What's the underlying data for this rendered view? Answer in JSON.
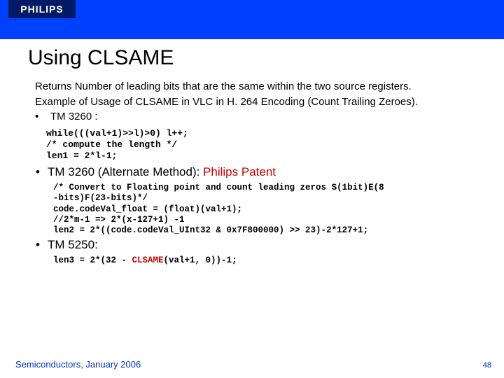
{
  "logo": "PHILIPS",
  "title": "Using CLSAME",
  "intro1": "Returns Number of leading bits that are the same within the two source registers.",
  "intro2": "Example of Usage of CLSAME in VLC in H. 264 Encoding (Count Trailing Zeroes).",
  "b1": "TM 3260 :",
  "code1": "while(((val+1)>>l)>0) l++;\n/* compute the length */\nlen1 = 2*l-1;",
  "b2a": "TM 3260 (Alternate Method): ",
  "b2b": "Philips Patent",
  "code2": "/* Convert to Floating point and count leading zeros S(1bit)E(8\n-bits)F(23-bits)*/\ncode.codeVal_float = (float)(val+1);\n//2*m-1 => 2*(x-127+1) -1\nlen2 = 2*((code.codeVal_UInt32 & 0x7F800000) >> 23)-2*127+1;",
  "b3": "TM 5250:",
  "code3a": "len3 = 2*(32 - ",
  "code3b": "CLSAME",
  "code3c": "(val+1, 0))-1;",
  "footer": "Semiconductors, January 2006",
  "page": "48"
}
